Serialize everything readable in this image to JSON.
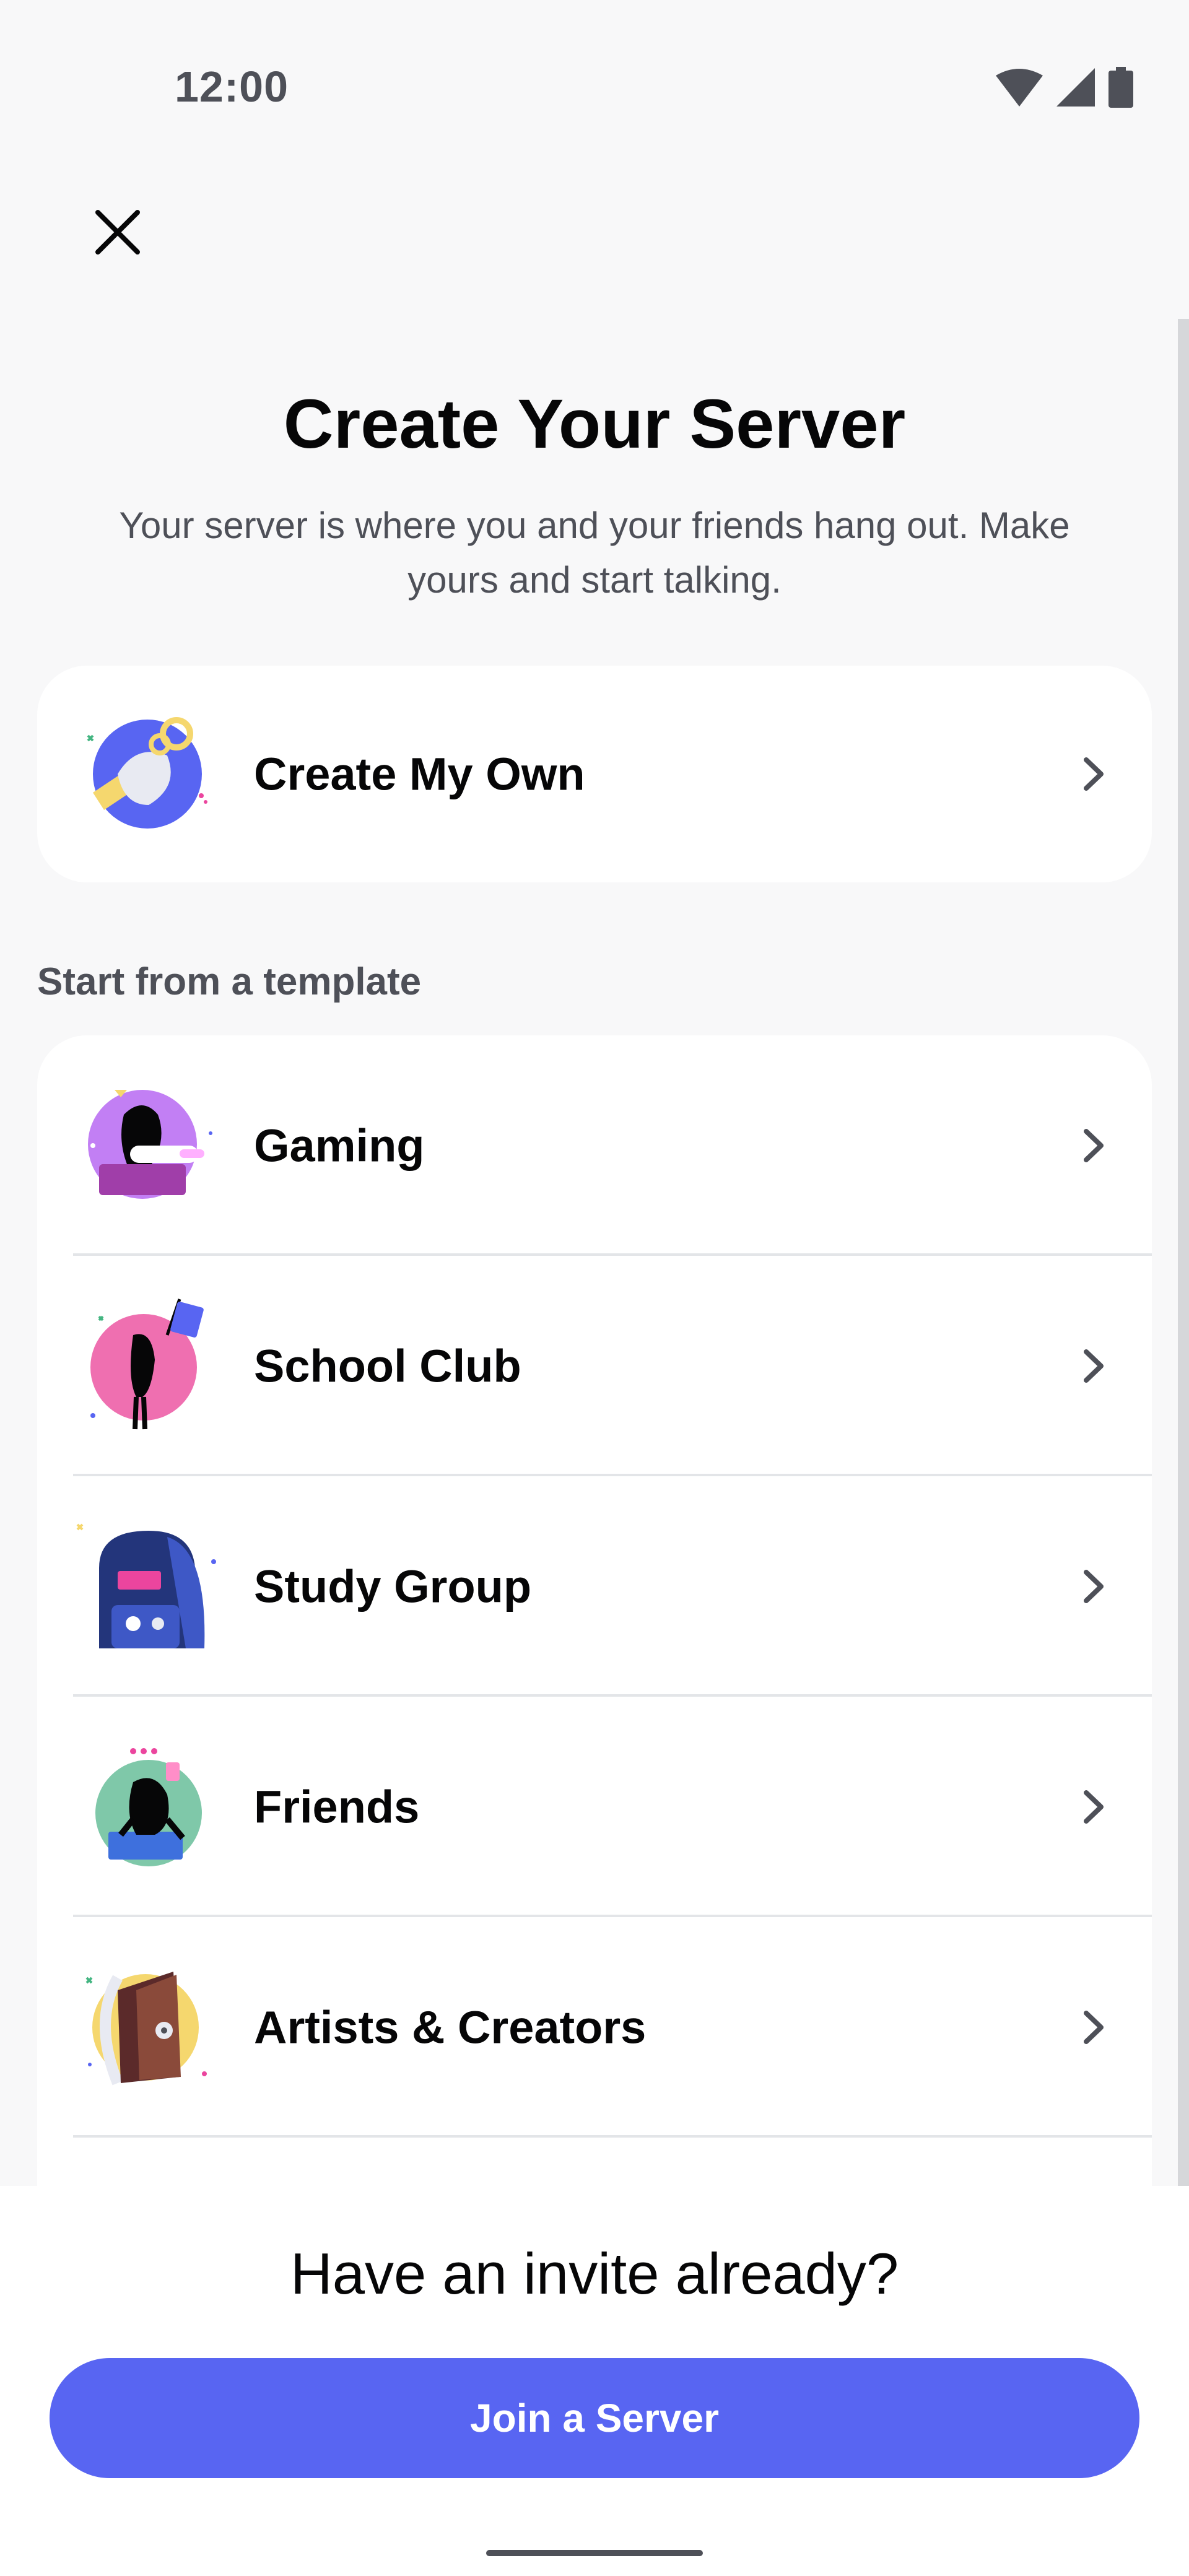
{
  "status_bar": {
    "time": "12:00"
  },
  "header": {
    "title": "Create Your Server",
    "subtitle": "Your server is where you and your friends hang out. Make yours and start talking."
  },
  "create_own": {
    "label": "Create My Own",
    "icon": "create-own-icon"
  },
  "templates": {
    "section_label": "Start from a template",
    "items": [
      {
        "label": "Gaming",
        "icon": "gaming-icon"
      },
      {
        "label": "School Club",
        "icon": "school-club-icon"
      },
      {
        "label": "Study Group",
        "icon": "study-group-icon"
      },
      {
        "label": "Friends",
        "icon": "friends-icon"
      },
      {
        "label": "Artists & Creators",
        "icon": "artists-creators-icon"
      }
    ]
  },
  "footer": {
    "heading": "Have an invite already?",
    "join_button": "Join a Server"
  },
  "colors": {
    "accent": "#5865f2",
    "background": "#f8f8f9",
    "card": "#ffffff"
  }
}
